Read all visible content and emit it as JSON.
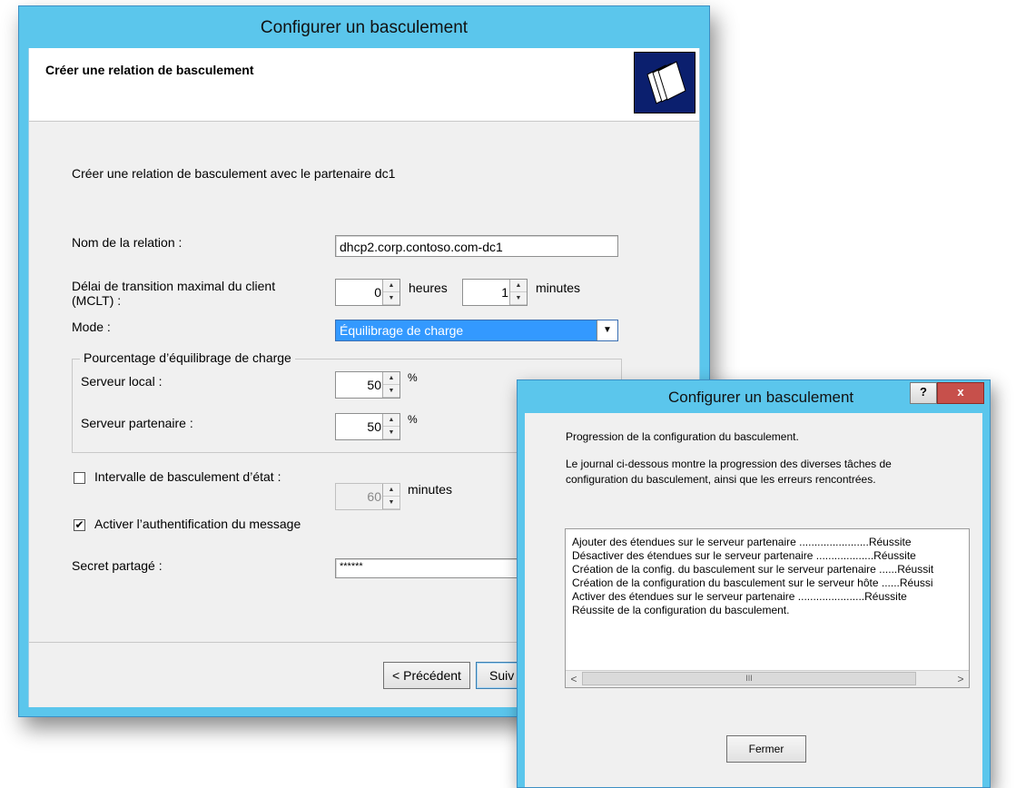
{
  "main_window": {
    "title": "Configurer un basculement",
    "header_title": "Créer une relation de basculement",
    "intro": "Créer une relation de basculement avec le partenaire dc1",
    "relation_label": "Nom de la relation :",
    "relation_value": "dhcp2.corp.contoso.com-dc1",
    "mclt_label_line1": "Délai de transition maximal du client",
    "mclt_label_line2": "(MCLT) :",
    "mclt_hours": "0",
    "hours_label": "heures",
    "mclt_minutes": "1",
    "minutes_label": "minutes",
    "mode_label": "Mode :",
    "mode_value": "Équilibrage de charge",
    "lb_group_label": "Pourcentage d’équilibrage de charge",
    "local_server_label": "Serveur local :",
    "local_server_value": "50",
    "partner_server_label": "Serveur partenaire :",
    "partner_server_value": "50",
    "percent": "%",
    "state_switch_label": "Intervalle de basculement d’état :",
    "state_switch_checked": false,
    "state_switch_value": "60",
    "state_switch_unit": "minutes",
    "auth_label": "Activer l’authentification du message",
    "auth_checked": true,
    "secret_label": "Secret partagé :",
    "secret_value": "******",
    "back_button": "< Précédent",
    "next_button": "Suiv"
  },
  "progress_dialog": {
    "title": "Configurer un basculement",
    "help_glyph": "?",
    "close_glyph": "x",
    "heading": "Progression de la configuration du basculement.",
    "desc_line1": "Le journal ci-dessous montre la progression des diverses tâches de",
    "desc_line2": "configuration du basculement, ainsi que les erreurs rencontrées.",
    "log": [
      "Ajouter des étendues sur le serveur partenaire .......................Réussite",
      "Désactiver des étendues sur le serveur partenaire ...................Réussite",
      "Création de la config. du basculement sur le serveur partenaire ......Réussit",
      "Création de la configuration du basculement sur le serveur hôte ......Réussi",
      "Activer des étendues sur le serveur partenaire ......................Réussite",
      "Réussite de la configuration du basculement."
    ],
    "scroll_left": "<",
    "scroll_grip": "III",
    "scroll_right": ">",
    "close_button": "Fermer"
  },
  "colors": {
    "titlebar": "#5bc6ec",
    "selection": "#3399ff",
    "close_red": "#c7504b"
  }
}
